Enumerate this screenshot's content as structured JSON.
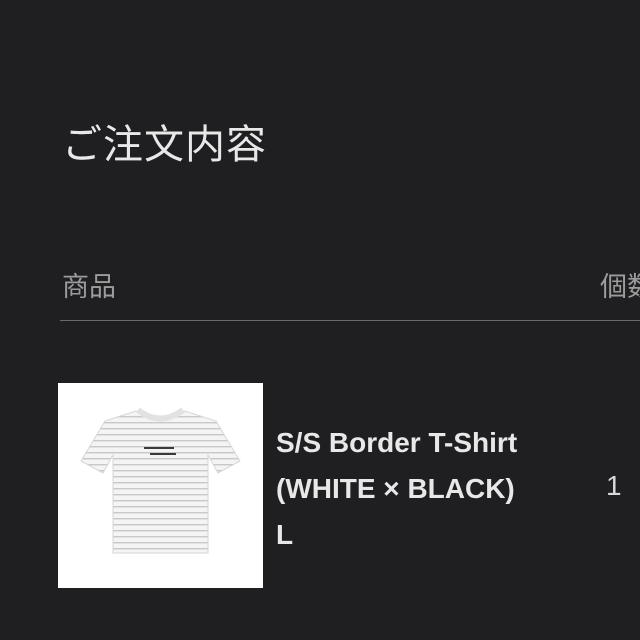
{
  "page": {
    "title": "ご注文内容"
  },
  "table": {
    "headers": {
      "product": "商品",
      "quantity": "個数"
    },
    "rows": [
      {
        "name_line1": "S/S Border T-Shirt",
        "name_line2": "(WHITE × BLACK)",
        "size": "L",
        "quantity": "1",
        "image_icon": "tshirt-thumbnail"
      }
    ]
  },
  "colors": {
    "background": "#1f1f22",
    "text": "#e8e8e8",
    "muted_text": "#9c9c9c",
    "divider": "#6a6a6a"
  }
}
